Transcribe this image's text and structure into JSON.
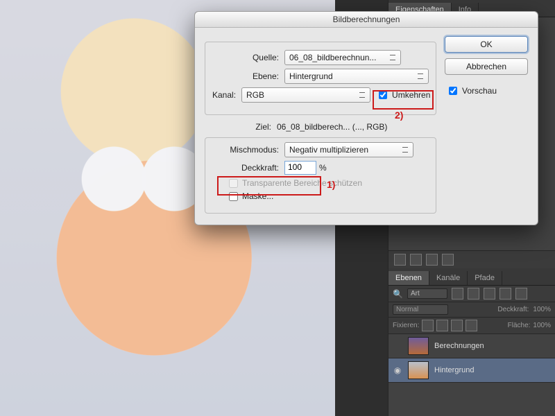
{
  "right_panel": {
    "tabs_top": [
      "Eigenschaften",
      "Info"
    ],
    "layers_tabs": [
      "Ebenen",
      "Kanäle",
      "Pfade"
    ],
    "search_kind": "Art",
    "blend_mode": "Normal",
    "opacity_label": "Deckkraft:",
    "opacity_value": "100%",
    "lock_label": "Fixieren:",
    "fill_label": "Fläche:",
    "fill_value": "100%",
    "layers": [
      {
        "visible": "",
        "name": "Berechnungen"
      },
      {
        "visible": "◉",
        "name": "Hintergrund"
      }
    ]
  },
  "dialog": {
    "title": "Bildberechnungen",
    "source_label": "Quelle:",
    "source_value": "06_08_bildberechnun...",
    "layer_label": "Ebene:",
    "layer_value": "Hintergrund",
    "channel_label": "Kanal:",
    "channel_value": "RGB",
    "invert_label": "Umkehren",
    "invert_checked": true,
    "target_label": "Ziel:",
    "target_value": "06_08_bildberech... (..., RGB)",
    "blend_label": "Mischmodus:",
    "blend_value": "Negativ multiplizieren",
    "opacity_label": "Deckkraft:",
    "opacity_value": "100",
    "opacity_pct": "%",
    "transp_label": "Transparente Bereiche schützen",
    "mask_label": "Maske...",
    "ok": "OK",
    "cancel": "Abbrechen",
    "preview_label": "Vorschau",
    "preview_checked": true,
    "annot1": "1)",
    "annot2": "2)"
  }
}
